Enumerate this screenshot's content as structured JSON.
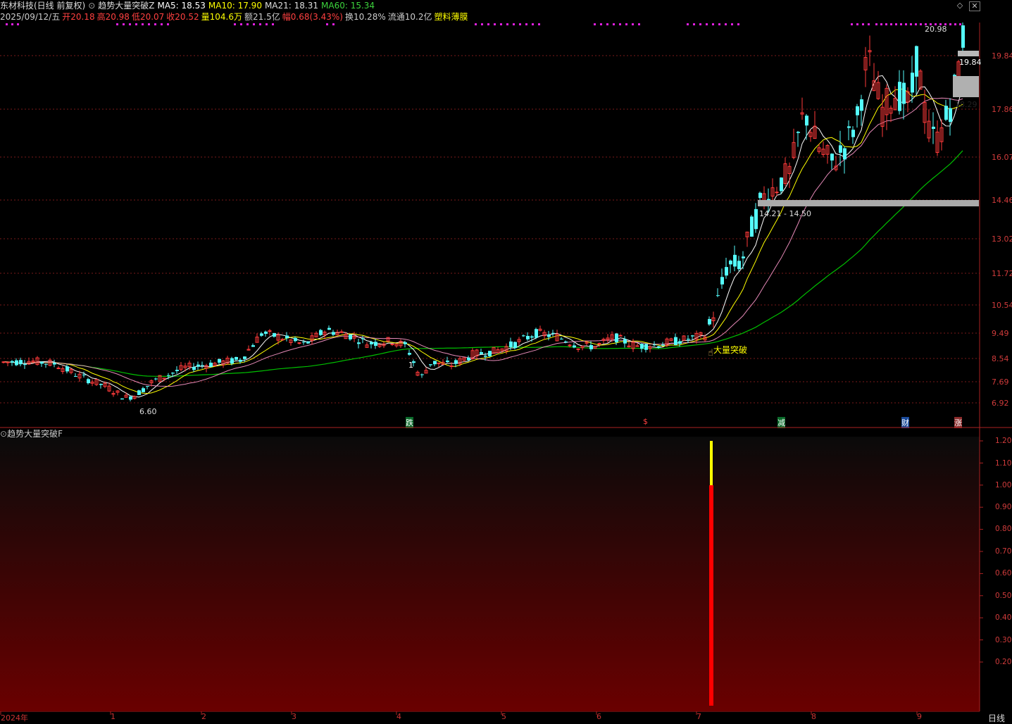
{
  "header": {
    "stock_name": "东材科技(日线 前复权)",
    "indicator_name": "趋势大量突破Z",
    "ma5": "MA5: 18.53",
    "ma10": "MA10: 17.90",
    "ma21": "MA21: 18.31",
    "ma60": "MA60: 15.34"
  },
  "info": {
    "date": "2025/09/12/五",
    "open": "开20.18",
    "high": "高20.98",
    "low": "低20.07",
    "close": "收20.52",
    "volume": "量104.6万",
    "amount": "额21.5亿",
    "change": "幅0.68(3.43%)",
    "turnover": "换10.28%",
    "float": "流通10.2亿",
    "sector": "塑料薄膜"
  },
  "main_chart": {
    "y_ticks": [
      "19.84",
      "17.86",
      "16.07",
      "14.46",
      "13.02",
      "11.72",
      "10.54",
      "9.49",
      "8.54",
      "7.69",
      "6.92"
    ],
    "high_label": "20.98",
    "low_label": "6.60",
    "box_label_1": "19.84",
    "box_label_2": "18.29",
    "zone_label": "14.21 - 14.50",
    "signal_label": "大量突破",
    "marker_1": "1",
    "event_tags": [
      "跌",
      "$",
      "减",
      "财",
      "涨"
    ],
    "colors": {
      "up": "#ff3a3a",
      "down": "#54fcfc",
      "ma5": "#ffffff",
      "ma10": "#ffff00",
      "ma21": "#ff99cc",
      "ma60": "#00c000"
    }
  },
  "sub_chart": {
    "title": "趋势大量突破F",
    "y_ticks": [
      "1.20",
      "1.10",
      "1.00",
      "0.90",
      "0.80",
      "0.70",
      "0.60",
      "0.50",
      "0.40",
      "0.30",
      "0.20"
    ],
    "signal_value": 1.2
  },
  "x_axis": {
    "labels": [
      "2024年",
      "1",
      "2",
      "3",
      "4",
      "5",
      "6",
      "7",
      "8",
      "9"
    ],
    "period": "日线"
  }
}
